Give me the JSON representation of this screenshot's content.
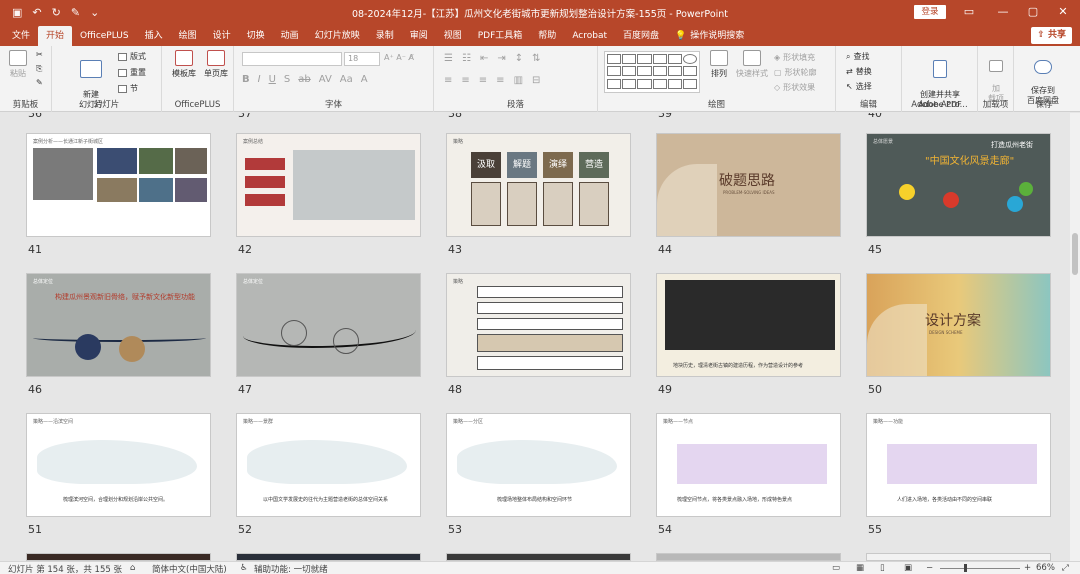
{
  "app": {
    "title": "08-2024年12月-【江苏】瓜州文化老街城市更新规划整治设计方案-155页  -  PowerPoint",
    "login_label": "登录",
    "share_label": "共享"
  },
  "tabs": [
    {
      "label": "文件"
    },
    {
      "label": "开始"
    },
    {
      "label": "OfficePLUS"
    },
    {
      "label": "插入"
    },
    {
      "label": "绘图"
    },
    {
      "label": "设计"
    },
    {
      "label": "切换"
    },
    {
      "label": "动画"
    },
    {
      "label": "幻灯片放映"
    },
    {
      "label": "录制"
    },
    {
      "label": "审阅"
    },
    {
      "label": "视图"
    },
    {
      "label": "PDF工具箱"
    },
    {
      "label": "帮助"
    },
    {
      "label": "Acrobat"
    },
    {
      "label": "百度网盘"
    },
    {
      "label": "操作说明搜索"
    }
  ],
  "ribbon": {
    "clipboard": {
      "paste": "粘贴",
      "label": "剪贴板"
    },
    "slides": {
      "new_slide": "新建\n幻灯片",
      "layout": "版式",
      "reset": "重置",
      "section": "节",
      "label": "幻灯片"
    },
    "officeplus": {
      "template_lib": "模板库",
      "single_lib": "单页库",
      "label": "OfficePLUS"
    },
    "font": {
      "label": "字体",
      "size": "18"
    },
    "paragraph": {
      "label": "段落"
    },
    "drawing": {
      "arrange": "排列",
      "quick_styles": "快速样式",
      "fill": "形状填充",
      "outline": "形状轮廓",
      "effects": "形状效果",
      "label": "绘图"
    },
    "editing": {
      "find": "查找",
      "replace": "替换",
      "select": "选择",
      "label": "编辑"
    },
    "acrobat": {
      "create": "创建并共享\nAdobe PDF",
      "label": "Adobe Acro..."
    },
    "addins": {
      "addins": "加\n载项",
      "label": "加载项"
    },
    "save": {
      "save_to": "保存到\n百度网盘",
      "label": "保存"
    }
  },
  "slides": [
    {
      "num": "41",
      "header": "案例分析——长通江新子街城区"
    },
    {
      "num": "42",
      "header": "案例总结"
    },
    {
      "num": "43",
      "header": "策略",
      "words": [
        "汲取",
        "解题",
        "演绎",
        "营造"
      ]
    },
    {
      "num": "44",
      "title": "破题思路",
      "subtitle": "PROBLEM-SOLVING IDEAS"
    },
    {
      "num": "45",
      "header": "总体愿景",
      "title_small": "打造瓜州老街",
      "title_big": "\"中国文化风景走廊\""
    },
    {
      "num": "46",
      "header": "总体定位",
      "title": "构建瓜州景观新旧骨络，赋予新文化新型功能"
    },
    {
      "num": "47",
      "header": "总体定位"
    },
    {
      "num": "48",
      "header": "策略"
    },
    {
      "num": "49",
      "caption": "地块历史，理清老街古镇的建造历程，作为营造设计的参考"
    },
    {
      "num": "50",
      "title": "设计方案",
      "subtitle": "DESIGN SCHEME"
    },
    {
      "num": "51",
      "header": "策略——沿滨空间",
      "caption": "梳理滨河空间，合理划分和规划沿岸公共空间。"
    },
    {
      "num": "52",
      "header": "策略——景群",
      "caption": "以中国文学发展史的往代为主题营造老街的总体空间关系"
    },
    {
      "num": "53",
      "header": "策略——分区",
      "caption": "梳理场地整体布局结构和空间环节"
    },
    {
      "num": "54",
      "header": "策略——节点",
      "caption": "梳理空间节点，将各类景点融入场地，形成特色景点"
    },
    {
      "num": "55",
      "header": "策略——功能",
      "caption": "人们进入场地，各类活动由不同的空间串联"
    }
  ],
  "status": {
    "slide_count": "幻灯片 第 154 张，共 155 张",
    "language": "简体中文(中国大陆)",
    "accessibility": "辅助功能: 一切就绪",
    "zoom": "66%"
  },
  "colors": {
    "accent": "#b7472a",
    "ribbon_bg": "#f3f3f3",
    "workspace_bg": "#e6e6e6"
  }
}
